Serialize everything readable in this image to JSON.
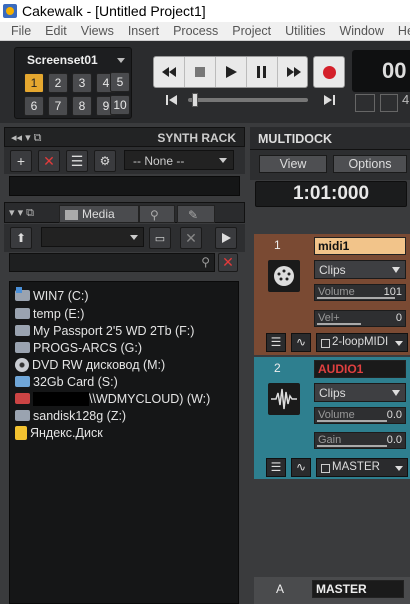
{
  "window": {
    "title": "Cakewalk - [Untitled Project1]"
  },
  "menu": [
    "File",
    "Edit",
    "Views",
    "Insert",
    "Process",
    "Project",
    "Utilities",
    "Window",
    "He"
  ],
  "screenset": {
    "label": "Screenset01",
    "buttons": [
      "1",
      "2",
      "3",
      "4",
      "5",
      "6",
      "7",
      "8",
      "9",
      "10"
    ],
    "selected": "1"
  },
  "transport": {
    "time_partial": "00",
    "digit_partial": "4"
  },
  "synth_rack": {
    "title": "SYNTH RACK",
    "selector": "-- None --"
  },
  "media": {
    "tabs": [
      "Media"
    ],
    "drives": [
      "WIN7 (C:)",
      "temp (E:)",
      "My Passport 2'5 WD 2Tb (F:)",
      "PROGS-ARCS (G:)",
      "DVD RW дисковод (M:)",
      "32Gb Card (S:)",
      "\\\\WDMYCLOUD) (W:)",
      "sandisk128g (Z:)",
      "Яндекс.Диск"
    ]
  },
  "multidock": {
    "title": "MULTIDOCK",
    "view_label": "View",
    "options_label": "Options",
    "now_time": "1:01:000",
    "tracks": [
      {
        "number": "1",
        "name": "midi1",
        "mode": "Clips",
        "fader1_label": "Volume",
        "fader1_value": "101",
        "fader2_label": "Vel+",
        "fader2_value": "0",
        "output": "2-loopMIDI",
        "color": "#7a4a33",
        "name_color": "#111",
        "name_bg": "#f2c48a"
      },
      {
        "number": "2",
        "name": "AUDIO1",
        "mode": "Clips",
        "fader1_label": "Volume",
        "fader1_value": "0.0",
        "fader2_label": "Gain",
        "fader2_value": "0.0",
        "output": "MASTER",
        "color": "#2e7f8f",
        "name_color": "#e04040",
        "name_bg": "#1a1a1a"
      }
    ],
    "master": {
      "letter": "A",
      "name": "MASTER"
    }
  },
  "colors": {
    "accent": "#e5a72f",
    "record": "#d4202a"
  }
}
